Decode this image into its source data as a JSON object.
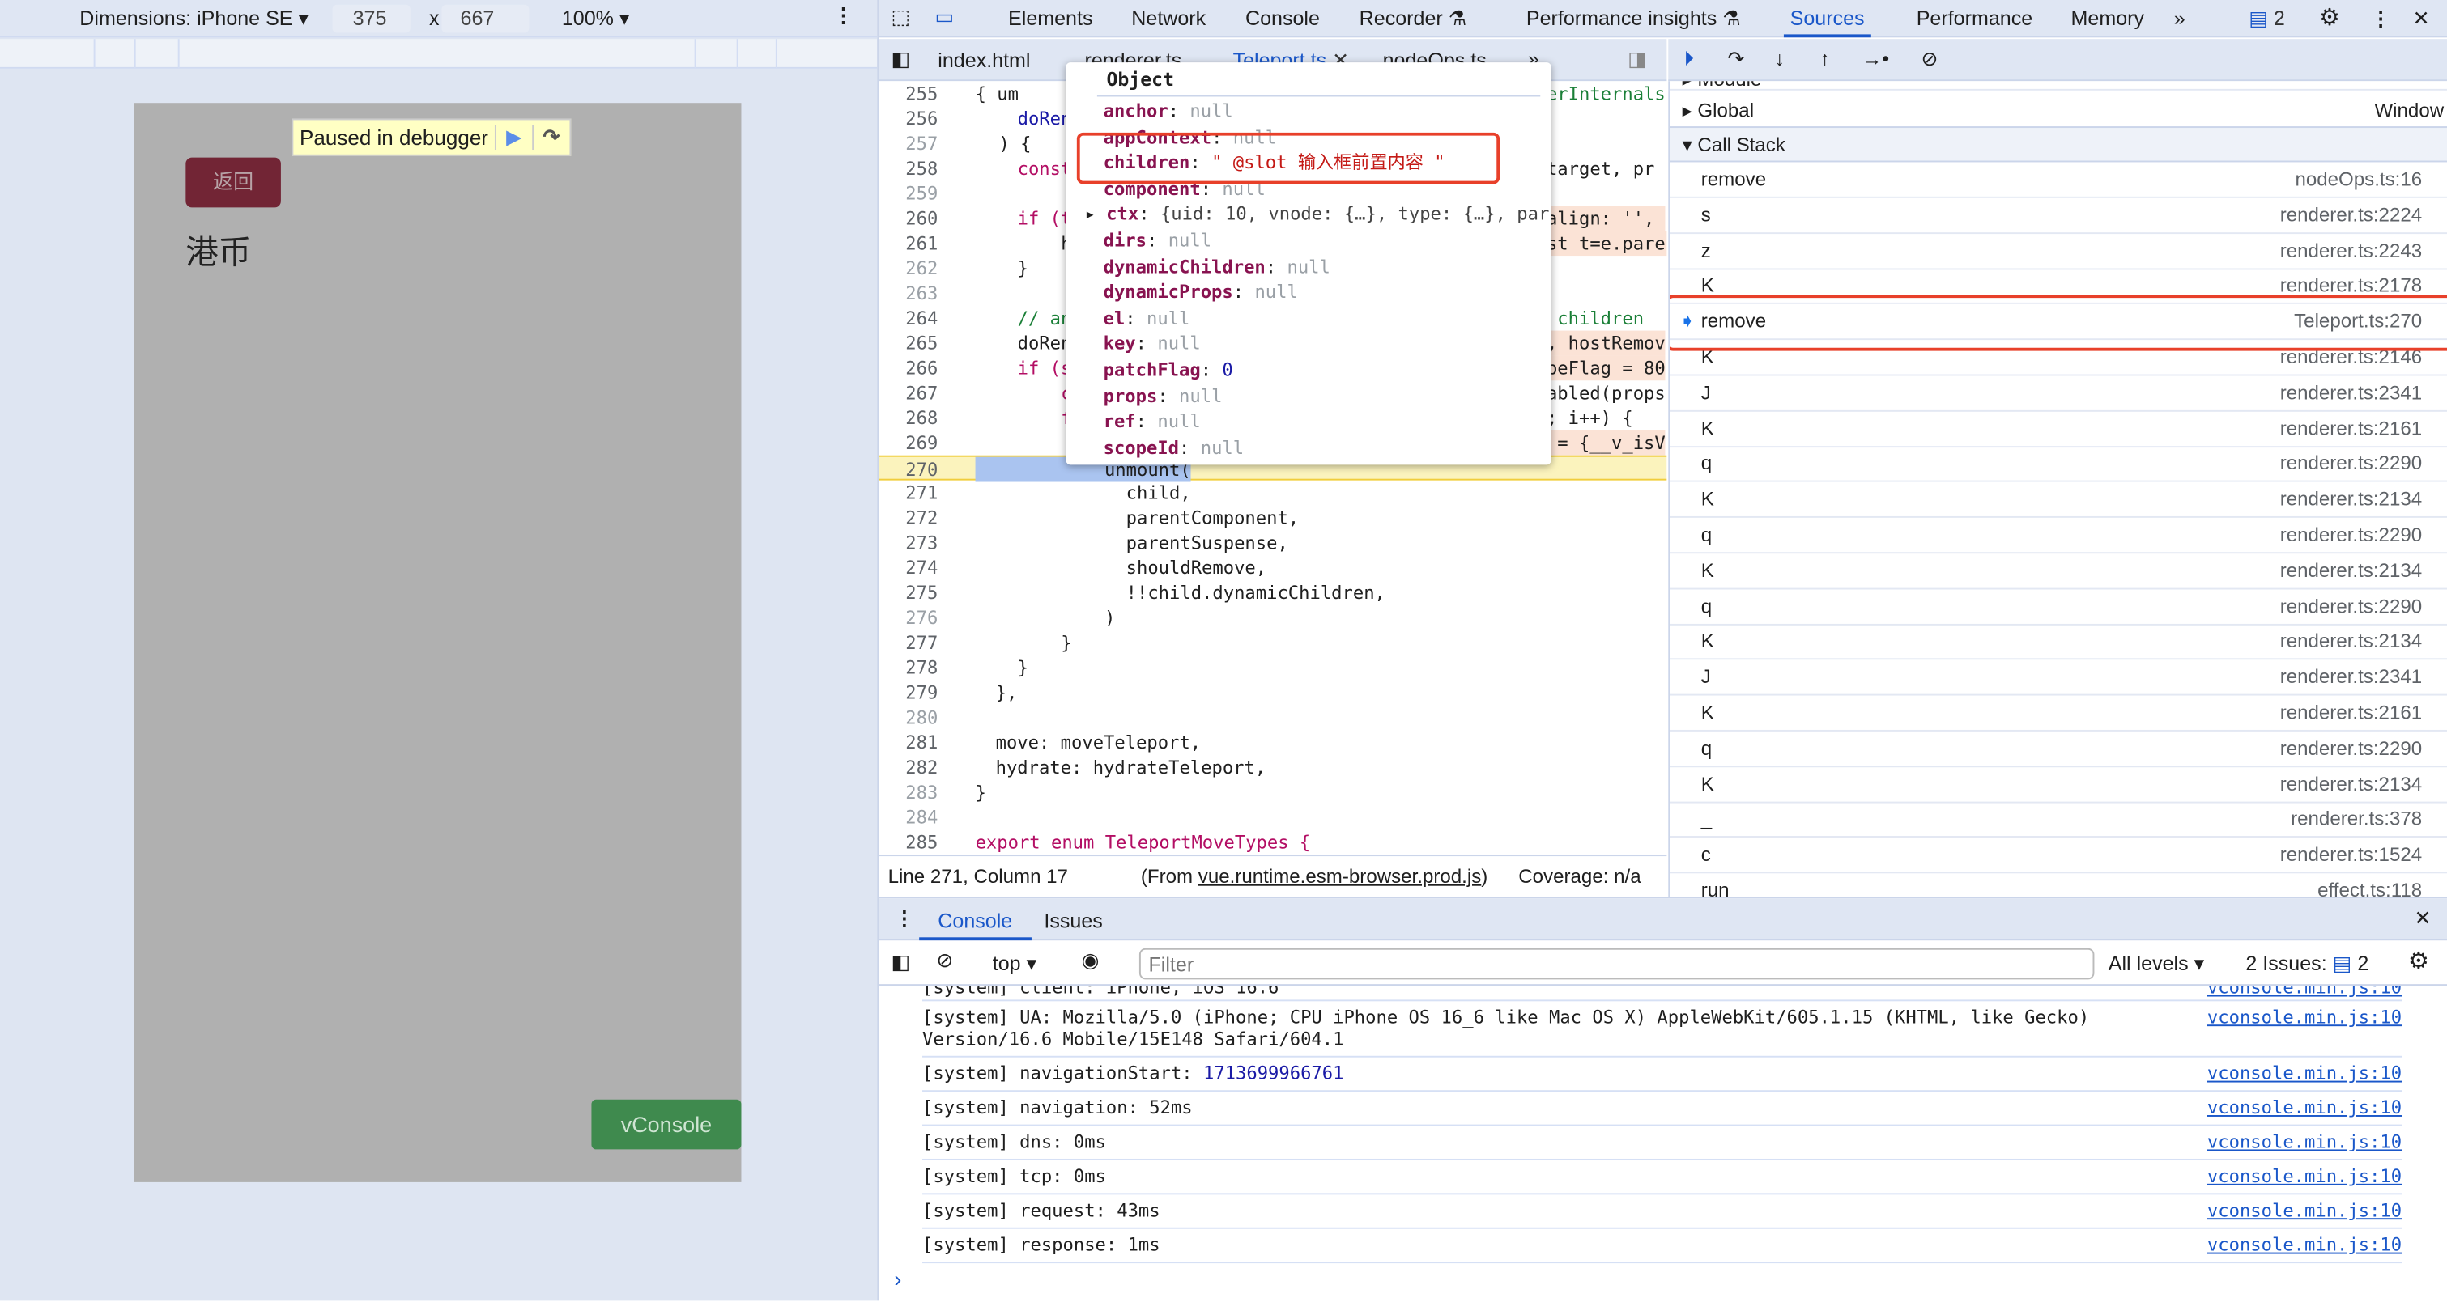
{
  "device_toolbar": {
    "dimensions_label": "Dimensions: iPhone SE",
    "width": "375",
    "times": "x",
    "height": "667",
    "zoom": "100%"
  },
  "page": {
    "paused_label": "Paused in debugger",
    "back_button": "返回",
    "heading": "港币",
    "vconsole_button": "vConsole",
    "back_color": "#722535",
    "vconsole_color": "#3f8a4e"
  },
  "devtools": {
    "tabs": [
      "Elements",
      "Network",
      "Console",
      "Recorder",
      "Performance insights",
      "Sources",
      "Performance",
      "Memory"
    ],
    "active_tab": "Sources",
    "issues_count": "2",
    "file_tabs": [
      "index.html",
      "renderer.ts",
      "Teleport.ts",
      "nodeOps.ts"
    ],
    "active_file": "Teleport.ts",
    "code_lines": [
      {
        "n": "255",
        "l": "{ um",
        "r": "erInternals"
      },
      {
        "n": "256",
        "l": "doRen",
        "r": ""
      },
      {
        "n": "257",
        "l": ") {",
        "r": ""
      },
      {
        "n": "258",
        "l": "const",
        "r": "target, pr"
      },
      {
        "n": "259",
        "l": "",
        "r": ""
      },
      {
        "n": "260",
        "l": "if (t",
        "r": "align: '', "
      },
      {
        "n": "261",
        "l": "  hos",
        "r": "st t=e.paren"
      },
      {
        "n": "262",
        "l": "}",
        "r": ""
      },
      {
        "n": "263",
        "l": "",
        "r": ""
      },
      {
        "n": "264",
        "l": "// an",
        "r": " children "
      },
      {
        "n": "265",
        "l": "doRen",
        "r": ", hostRemov"
      },
      {
        "n": "266",
        "l": "if (s",
        "r": "peFlag = 80"
      },
      {
        "n": "267",
        "l": "  con",
        "r": "abled(props)"
      },
      {
        "n": "268",
        "l": "  for",
        "r": "; i++) {"
      },
      {
        "n": "269",
        "l": "    c",
        "r": " = {__v_isV"
      },
      {
        "n": "270",
        "l": "    unmount(",
        "r": ""
      },
      {
        "n": "271",
        "l": "      child,",
        "r": ""
      },
      {
        "n": "272",
        "l": "      parentComponent,",
        "r": ""
      },
      {
        "n": "273",
        "l": "      parentSuspense,",
        "r": ""
      },
      {
        "n": "274",
        "l": "      shouldRemove,",
        "r": ""
      },
      {
        "n": "275",
        "l": "      !!child.dynamicChildren,",
        "r": ""
      },
      {
        "n": "276",
        "l": "    )",
        "r": ""
      },
      {
        "n": "277",
        "l": "  }",
        "r": ""
      },
      {
        "n": "278",
        "l": "}",
        "r": ""
      },
      {
        "n": "279",
        "l": "},",
        "r": ""
      },
      {
        "n": "280",
        "l": "",
        "r": ""
      },
      {
        "n": "281",
        "l": "move: moveTeleport,",
        "r": ""
      },
      {
        "n": "282",
        "l": "hydrate: hydrateTeleport,",
        "r": ""
      },
      {
        "n": "283",
        "l": "}",
        "r": ""
      },
      {
        "n": "284",
        "l": "",
        "r": ""
      },
      {
        "n": "285",
        "l": "export enum TeleportMoveTypes {",
        "r": ""
      }
    ],
    "status": {
      "position": "Line 271, Column 17",
      "from_prefix": "(From ",
      "from_file": "vue.runtime.esm-browser.prod.js",
      "from_suffix": ")",
      "coverage": "Coverage: n/a"
    },
    "popover": {
      "title": "Object",
      "props": [
        {
          "k": "anchor",
          "v": "null"
        },
        {
          "k": "appContext",
          "v": "null"
        },
        {
          "k": "children",
          "v": "\" @slot 输入框前置内容 \""
        },
        {
          "k": "component",
          "v": "null"
        },
        {
          "k": "ctx",
          "v": "{uid: 10, vnode: {…}, type: {…}, par"
        },
        {
          "k": "dirs",
          "v": "null"
        },
        {
          "k": "dynamicChildren",
          "v": "null"
        },
        {
          "k": "dynamicProps",
          "v": "null"
        },
        {
          "k": "el",
          "v": "null"
        },
        {
          "k": "key",
          "v": "null"
        },
        {
          "k": "patchFlag",
          "v": "0"
        },
        {
          "k": "props",
          "v": "null"
        },
        {
          "k": "ref",
          "v": "null"
        },
        {
          "k": "scopeId",
          "v": "null"
        }
      ]
    },
    "scope": {
      "module": "Module",
      "global": "Global",
      "global_value": "Window",
      "call_stack": "Call Stack"
    },
    "call_stack": [
      {
        "fn": "remove",
        "loc": "nodeOps.ts:16"
      },
      {
        "fn": "s",
        "loc": "renderer.ts:2224"
      },
      {
        "fn": "z",
        "loc": "renderer.ts:2243"
      },
      {
        "fn": "K",
        "loc": "renderer.ts:2178"
      },
      {
        "fn": "remove",
        "loc": "Teleport.ts:270",
        "current": true
      },
      {
        "fn": "K",
        "loc": "renderer.ts:2146"
      },
      {
        "fn": "J",
        "loc": "renderer.ts:2341"
      },
      {
        "fn": "K",
        "loc": "renderer.ts:2161"
      },
      {
        "fn": "q",
        "loc": "renderer.ts:2290"
      },
      {
        "fn": "K",
        "loc": "renderer.ts:2134"
      },
      {
        "fn": "q",
        "loc": "renderer.ts:2290"
      },
      {
        "fn": "K",
        "loc": "renderer.ts:2134"
      },
      {
        "fn": "q",
        "loc": "renderer.ts:2290"
      },
      {
        "fn": "K",
        "loc": "renderer.ts:2134"
      },
      {
        "fn": "J",
        "loc": "renderer.ts:2341"
      },
      {
        "fn": "K",
        "loc": "renderer.ts:2161"
      },
      {
        "fn": "q",
        "loc": "renderer.ts:2290"
      },
      {
        "fn": "K",
        "loc": "renderer.ts:2134"
      },
      {
        "fn": "_",
        "loc": "renderer.ts:378"
      },
      {
        "fn": "c",
        "loc": "renderer.ts:1524"
      },
      {
        "fn": "run",
        "loc": "effect.ts:118"
      }
    ],
    "console": {
      "tabs": [
        "Console",
        "Issues"
      ],
      "context": "top",
      "filter_placeholder": "Filter",
      "levels": "All levels",
      "issues_label": "2 Issues:",
      "issues_count": "2",
      "messages": [
        {
          "text": "[system] client: iPhone, iOS 16.6",
          "src": "vconsole.min.js:10"
        },
        {
          "text": "[system] UA: Mozilla/5.0 (iPhone; CPU iPhone OS 16_6 like Mac OS X) AppleWebKit/605.1.15 (KHTML, like Gecko)\nVersion/16.6 Mobile/15E148 Safari/604.1",
          "src": "vconsole.min.js:10"
        },
        {
          "text": "[system] navigationStart: ",
          "num": "1713699966761",
          "src": "vconsole.min.js:10"
        },
        {
          "text": "[system] navigation: 52ms",
          "src": "vconsole.min.js:10"
        },
        {
          "text": "[system] dns: 0ms",
          "src": "vconsole.min.js:10"
        },
        {
          "text": "[system] tcp: 0ms",
          "src": "vconsole.min.js:10"
        },
        {
          "text": "[system] request: 43ms",
          "src": "vconsole.min.js:10"
        },
        {
          "text": "[system] response: 1ms",
          "src": "vconsole.min.js:10"
        }
      ],
      "prompt": "›"
    }
  }
}
